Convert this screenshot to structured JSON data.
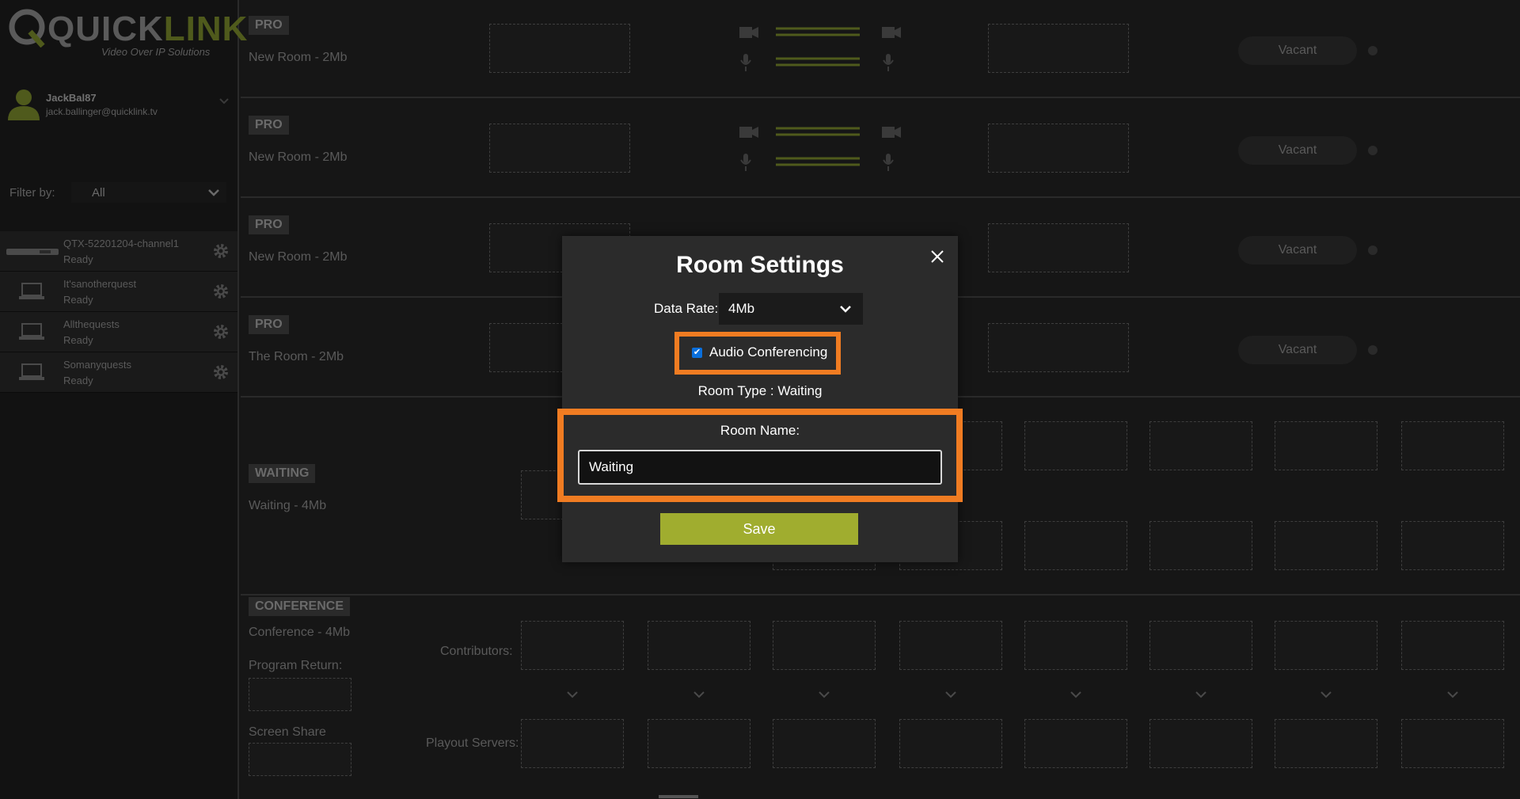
{
  "logo": {
    "brand_left": "QUICK",
    "brand_right": "LINK",
    "tagline": "Video Over IP Solutions"
  },
  "user": {
    "name": "JackBal87",
    "email": "jack.ballinger@quicklink.tv"
  },
  "filter": {
    "label": "Filter by:",
    "value": "All"
  },
  "endpoints": [
    {
      "name": "QTX-52201204-channel1",
      "status": "Ready",
      "icon": "hardware-device-icon"
    },
    {
      "name": "It'sanotherquest",
      "status": "Ready",
      "icon": "laptop-icon"
    },
    {
      "name": "Allthequests",
      "status": "Ready",
      "icon": "laptop-icon"
    },
    {
      "name": "Somanyquests",
      "status": "Ready",
      "icon": "laptop-icon"
    }
  ],
  "rooms": [
    {
      "badge": "PRO",
      "name": "New Room - 2Mb",
      "status": "Vacant"
    },
    {
      "badge": "PRO",
      "name": "New Room - 2Mb",
      "status": "Vacant"
    },
    {
      "badge": "PRO",
      "name": "New Room - 2Mb",
      "status": "Vacant"
    },
    {
      "badge": "PRO",
      "name": "The Room - 2Mb",
      "status": "Vacant"
    }
  ],
  "waiting": {
    "badge": "WAITING",
    "name": "Waiting - 4Mb"
  },
  "conference": {
    "badge": "CONFERENCE",
    "name": "Conference - 4Mb",
    "program_return": "Program Return:",
    "screen_share": "Screen Share",
    "contributors": "Contributors:",
    "playout_servers": "Playout Servers:"
  },
  "modal": {
    "title": "Room Settings",
    "data_rate_label": "Data Rate:",
    "data_rate_value": "4Mb",
    "audio_conferencing_label": "Audio Conferencing",
    "audio_conferencing_checked": true,
    "room_type": "Room Type : Waiting",
    "room_name_label": "Room Name:",
    "room_name_value": "Waiting",
    "save_label": "Save"
  },
  "colors": {
    "highlight": "#f07c22",
    "save_button": "#a0ad2f",
    "brand_green": "#4f5a1c"
  }
}
